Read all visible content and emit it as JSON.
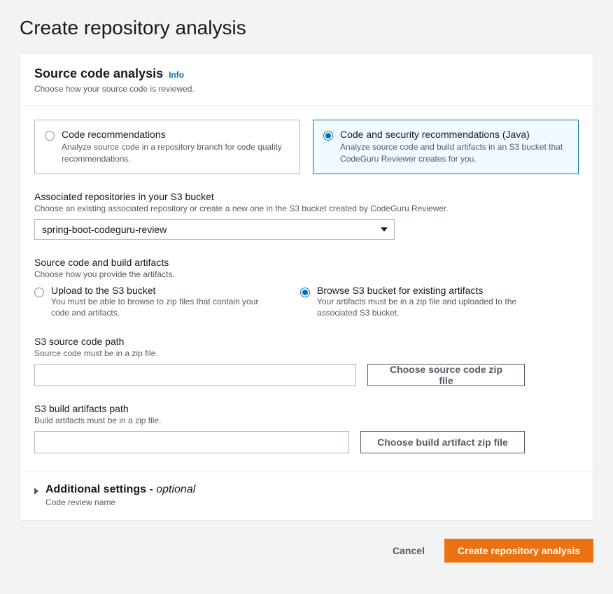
{
  "page_title": "Create repository analysis",
  "panel": {
    "title": "Source code analysis",
    "info": "Info",
    "subtitle": "Choose how your source code is reviewed."
  },
  "analysis_options": [
    {
      "title": "Code recommendations",
      "desc": "Analyze source code in a repository branch for code quality recommendations.",
      "selected": false
    },
    {
      "title": "Code and security recommendations (Java)",
      "desc": "Analyze source code and build artifacts in an S3 bucket that CodeGuru Reviewer creates for you.",
      "selected": true
    }
  ],
  "assoc_repo": {
    "label": "Associated repositories in your S3 bucket",
    "desc": "Choose an existing associated repository or create a new one in the S3 bucket created by CodeGuru Reviewer.",
    "value": "spring-boot-codeguru-review"
  },
  "artifacts_source": {
    "label": "Source code and build artifacts",
    "desc": "Choose how you provide the artifacts.",
    "options": [
      {
        "title": "Upload to the S3 bucket",
        "desc": "You must be able to browse to zip files that contain your code and artifacts.",
        "selected": false
      },
      {
        "title": "Browse S3 bucket for existing artifacts",
        "desc": "Your artifacts must be in a zip file and uploaded to the associated S3 bucket.",
        "selected": true
      }
    ]
  },
  "source_path": {
    "label": "S3 source code path",
    "desc": "Source code must be in a zip file.",
    "value": "",
    "button": "Choose source code zip file"
  },
  "build_path": {
    "label": "S3 build artifacts path",
    "desc": "Build artifacts must be in a zip file.",
    "value": "",
    "button": "Choose build artifact zip file"
  },
  "additional": {
    "title": "Additional settings - ",
    "optional": "optional",
    "sub": "Code review name"
  },
  "actions": {
    "cancel": "Cancel",
    "submit": "Create repository analysis"
  }
}
